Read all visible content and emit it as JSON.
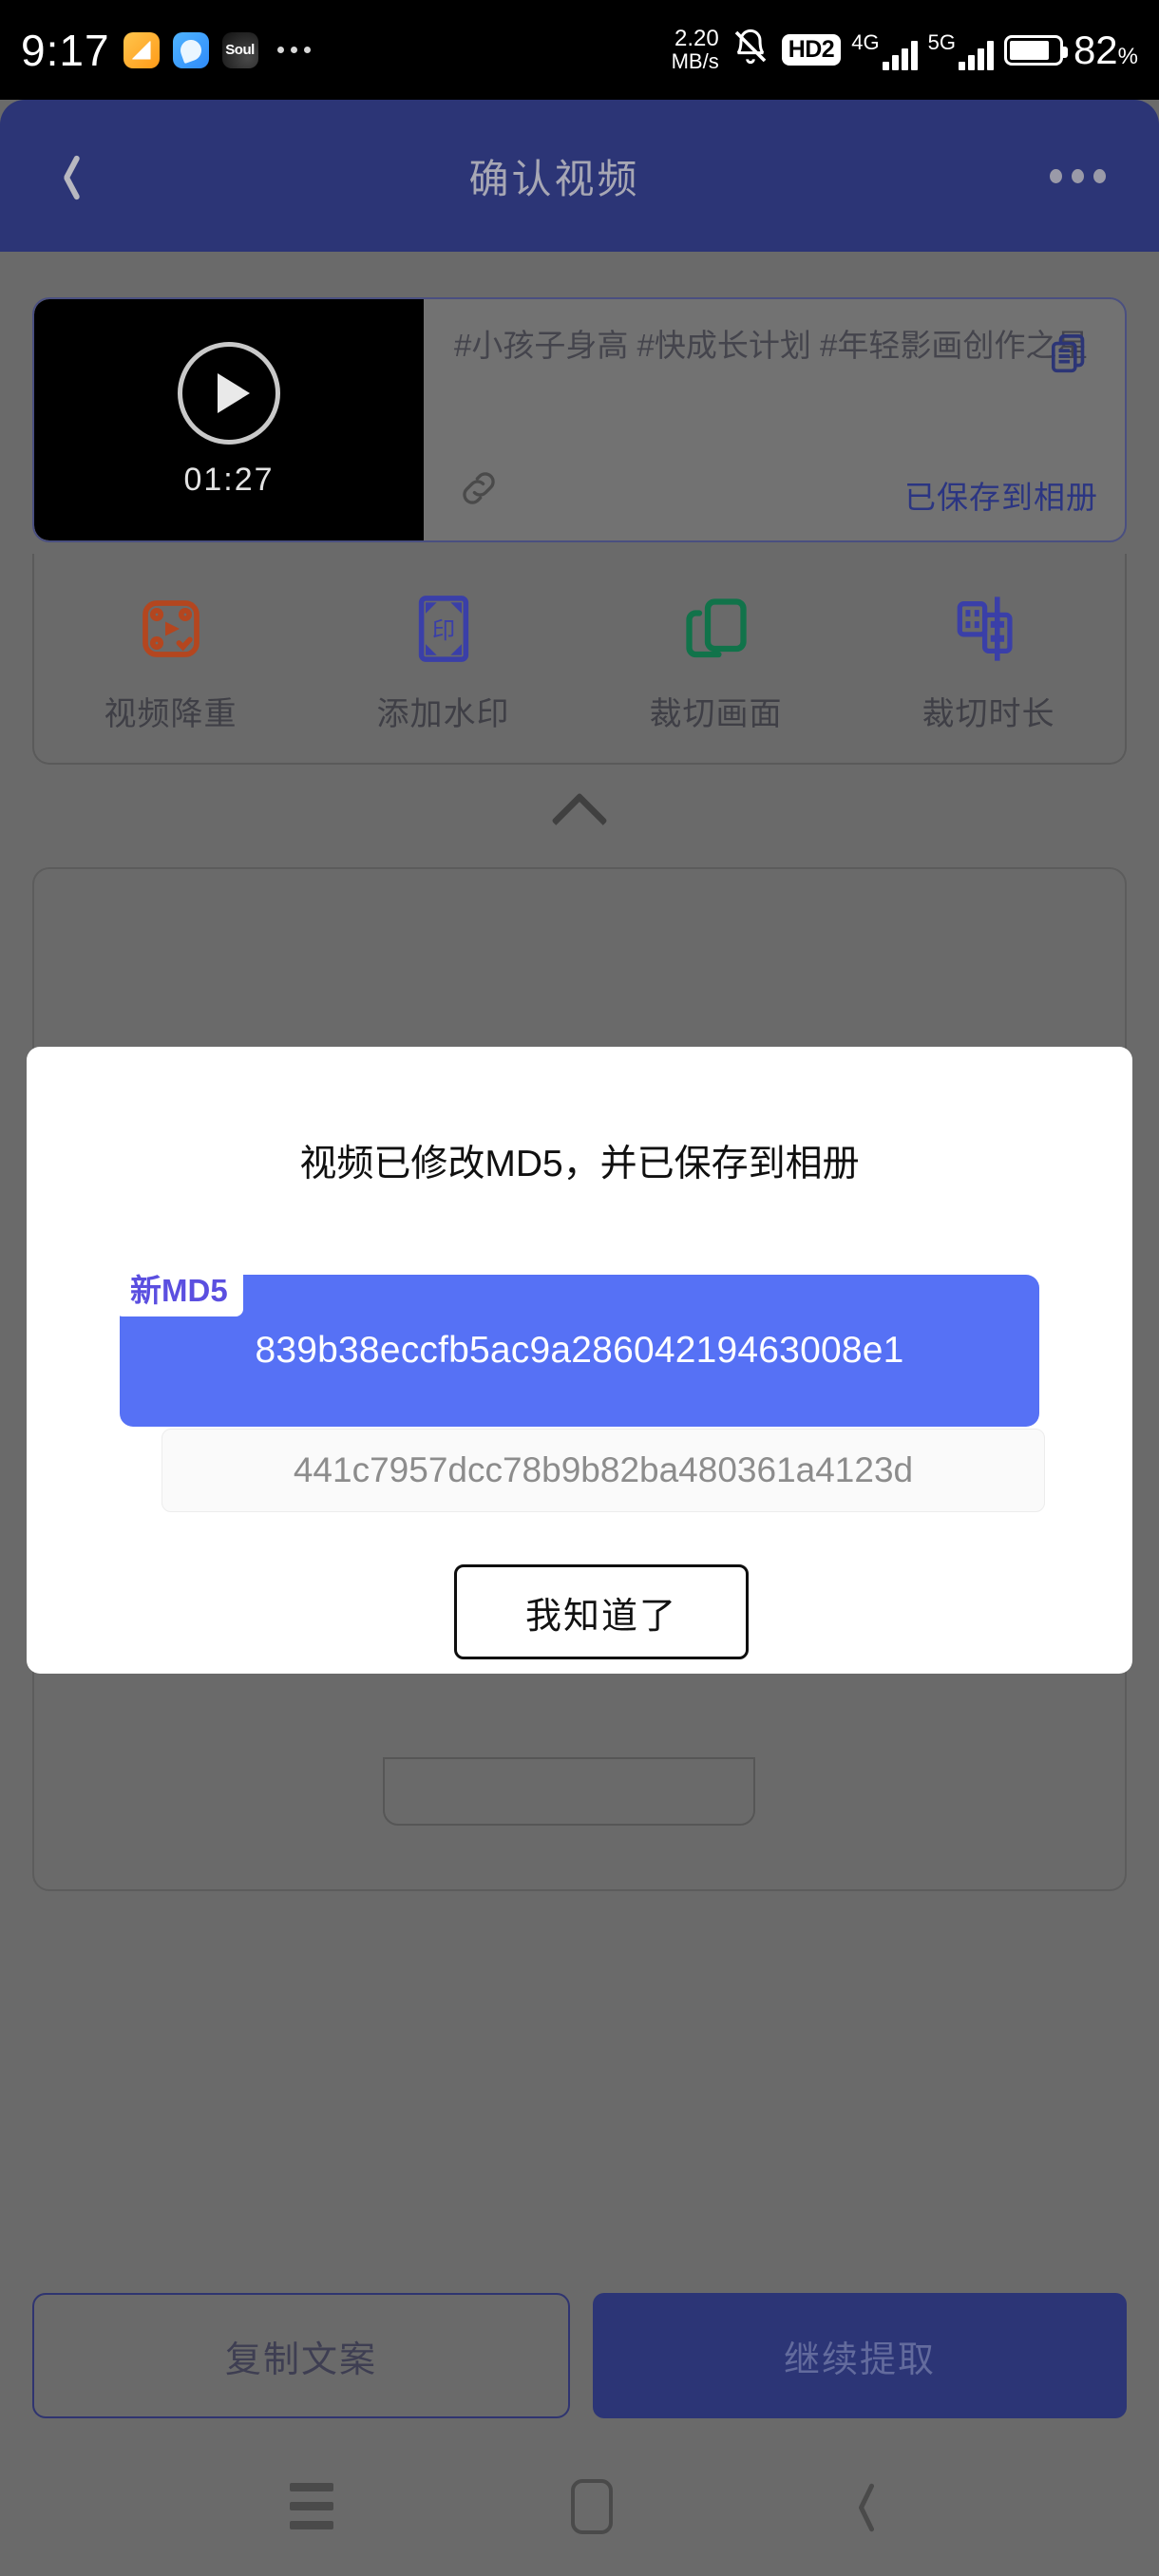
{
  "status_bar": {
    "time": "9:17",
    "app_icons": [
      "note-app-icon",
      "browser-app-icon",
      "soul-app-icon"
    ],
    "soul_label": "Soul",
    "overflow_icon": "more-dots-icon",
    "network_speed_value": "2.20",
    "network_speed_unit": "MB/s",
    "mute_icon": "bell-muted-icon",
    "hd_label": "HD2",
    "sim1_network": "4G",
    "sim2_network": "5G",
    "battery_percent": "82",
    "battery_percent_suffix": "%"
  },
  "header": {
    "back_icon": "back-chevron-icon",
    "title": "确认视频",
    "overflow_icon": "more-options-icon"
  },
  "video_card": {
    "duration": "01:27",
    "play_icon": "play-circle-icon",
    "caption": "#小孩子身高 #快成长计划 #年轻影画创作之星",
    "copy_icon": "copy-document-icon",
    "link_icon": "link-chain-icon",
    "saved_label": "已保存到相册",
    "saved_color": "#2b3582"
  },
  "tools": [
    {
      "label": "视频降重",
      "icon": "video-dedupe-icon",
      "color": "#b4461f"
    },
    {
      "label": "添加水印",
      "icon": "watermark-stamp-icon",
      "color": "#3a3fa8",
      "glyph": "印"
    },
    {
      "label": "裁切画面",
      "icon": "crop-frame-icon",
      "color": "#11734a"
    },
    {
      "label": "裁切时长",
      "icon": "trim-duration-icon",
      "color": "#3a3fa8"
    }
  ],
  "collapse_icon": "chevron-up-icon",
  "dialog": {
    "title": "视频已修改MD5，并已保存到相册",
    "new_badge": "新MD5",
    "new_md5": "839b38eccfb5ac9a28604219463008e1",
    "old_md5": "441c7957dcc78b9b82ba480361a4123d",
    "confirm_label": "我知道了",
    "accent_color": "#5671f5"
  },
  "bottom_actions": {
    "copy_text_label": "复制文案",
    "continue_label": "继续提取",
    "primary_color": "#2c3576"
  },
  "nav_bar": {
    "menu_icon": "menu-lines-icon",
    "home_icon": "home-square-icon",
    "back_icon": "nav-back-chevron-icon"
  }
}
